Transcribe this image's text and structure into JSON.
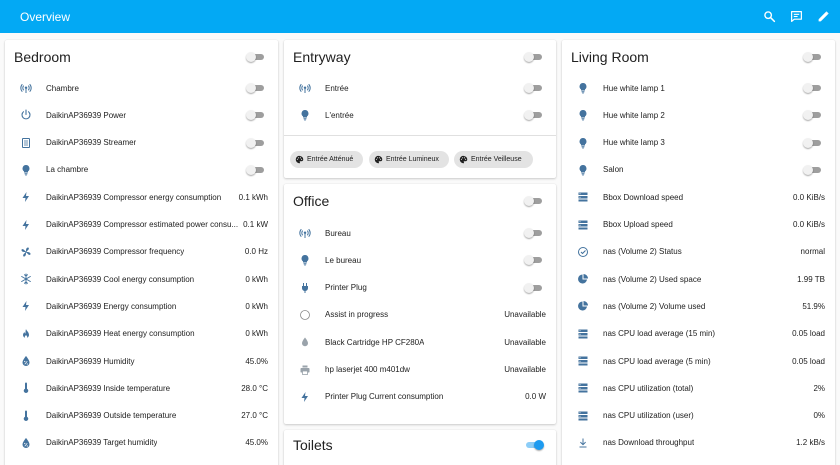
{
  "app": {
    "title": "Overview"
  },
  "header": {
    "search_icon": "search-icon",
    "chat_icon": "chat-icon",
    "edit_icon": "pencil-icon"
  },
  "colors": {
    "accent": "#03a9f4",
    "icon": "#44739e",
    "toggle_on": "#1d9bf0"
  },
  "bedroom": {
    "title": "Bedroom",
    "rows": [
      {
        "icon": "switch-icon",
        "label": "Chambre",
        "type": "toggle",
        "on": false
      },
      {
        "icon": "power-icon",
        "label": "DaikinAP36939 Power",
        "type": "toggle",
        "on": false
      },
      {
        "icon": "streamer-icon",
        "label": "DaikinAP36939 Streamer",
        "type": "toggle",
        "on": false
      },
      {
        "icon": "bulb-icon",
        "label": "La chambre",
        "type": "toggle",
        "on": false
      },
      {
        "icon": "flash-icon",
        "label": "DaikinAP36939 Compressor energy consumption",
        "type": "value",
        "value": "0.1 kWh"
      },
      {
        "icon": "flash-icon",
        "label": "DaikinAP36939 Compressor estimated power consu...",
        "type": "value",
        "value": "0.1 kW"
      },
      {
        "icon": "fan-icon",
        "label": "DaikinAP36939 Compressor frequency",
        "type": "value",
        "value": "0.0 Hz"
      },
      {
        "icon": "snowflake-icon",
        "label": "DaikinAP36939 Cool energy consumption",
        "type": "value",
        "value": "0 kWh"
      },
      {
        "icon": "flash-icon",
        "label": "DaikinAP36939 Energy consumption",
        "type": "value",
        "value": "0 kWh"
      },
      {
        "icon": "fire-icon",
        "label": "DaikinAP36939 Heat energy consumption",
        "type": "value",
        "value": "0 kWh"
      },
      {
        "icon": "water-percent-icon",
        "label": "DaikinAP36939 Humidity",
        "type": "value",
        "value": "45.0%"
      },
      {
        "icon": "thermometer-icon",
        "label": "DaikinAP36939 Inside temperature",
        "type": "value",
        "value": "28.0 °C"
      },
      {
        "icon": "thermometer-icon",
        "label": "DaikinAP36939 Outside temperature",
        "type": "value",
        "value": "27.0 °C"
      },
      {
        "icon": "water-percent-icon",
        "label": "DaikinAP36939 Target humidity",
        "type": "value",
        "value": "45.0%"
      }
    ]
  },
  "entryway": {
    "title": "Entryway",
    "rows": [
      {
        "icon": "switch-icon",
        "label": "Entrée",
        "type": "toggle",
        "on": false
      },
      {
        "icon": "bulb-icon",
        "label": "L'entrée",
        "type": "toggle",
        "on": false
      }
    ],
    "scenes": [
      "Entrée Atténué",
      "Entrée Lumineux",
      "Entrée Veilleuse"
    ]
  },
  "office": {
    "title": "Office",
    "rows": [
      {
        "icon": "switch-icon",
        "label": "Bureau",
        "type": "toggle",
        "on": false
      },
      {
        "icon": "bulb-icon",
        "label": "Le bureau",
        "type": "toggle",
        "on": false
      },
      {
        "icon": "plug-icon",
        "label": "Printer Plug",
        "type": "toggle",
        "on": false
      },
      {
        "icon": "circle-outline-icon",
        "label": "Assist in progress",
        "type": "value",
        "value": "Unavailable"
      },
      {
        "icon": "water-drop-icon",
        "label": "Black Cartridge HP CF280A",
        "type": "value",
        "value": "Unavailable"
      },
      {
        "icon": "printer-icon",
        "label": "hp laserjet 400 m401dw",
        "type": "value",
        "value": "Unavailable"
      },
      {
        "icon": "flash-icon",
        "label": "Printer Plug Current consumption",
        "type": "value",
        "value": "0.0 W"
      }
    ]
  },
  "toilets": {
    "title": "Toilets",
    "on": true
  },
  "living": {
    "title": "Living Room",
    "rows": [
      {
        "icon": "bulb-icon",
        "label": "Hue white lamp 1",
        "type": "toggle",
        "on": false
      },
      {
        "icon": "bulb-icon",
        "label": "Hue white lamp 2",
        "type": "toggle",
        "on": false
      },
      {
        "icon": "bulb-icon",
        "label": "Hue white lamp 3",
        "type": "toggle",
        "on": false
      },
      {
        "icon": "bulb-icon",
        "label": "Salon",
        "type": "toggle",
        "on": false
      },
      {
        "icon": "server-icon",
        "label": "Bbox Download speed",
        "type": "value",
        "value": "0.0 KiB/s"
      },
      {
        "icon": "server-icon",
        "label": "Bbox Upload speed",
        "type": "value",
        "value": "0.0 KiB/s"
      },
      {
        "icon": "check-circle-icon",
        "label": "nas (Volume 2) Status",
        "type": "value",
        "value": "normal"
      },
      {
        "icon": "chart-pie-icon",
        "label": "nas (Volume 2) Used space",
        "type": "value",
        "value": "1.99 TB"
      },
      {
        "icon": "chart-pie-icon",
        "label": "nas (Volume 2) Volume used",
        "type": "value",
        "value": "51.9%"
      },
      {
        "icon": "server-icon",
        "label": "nas CPU load average (15 min)",
        "type": "value",
        "value": "0.05 load"
      },
      {
        "icon": "server-icon",
        "label": "nas CPU load average (5 min)",
        "type": "value",
        "value": "0.05 load"
      },
      {
        "icon": "server-icon",
        "label": "nas CPU utilization (total)",
        "type": "value",
        "value": "2%"
      },
      {
        "icon": "server-icon",
        "label": "nas CPU utilization (user)",
        "type": "value",
        "value": "0%"
      },
      {
        "icon": "download-icon",
        "label": "nas Download throughput",
        "type": "value",
        "value": "1.2 kB/s"
      }
    ]
  }
}
